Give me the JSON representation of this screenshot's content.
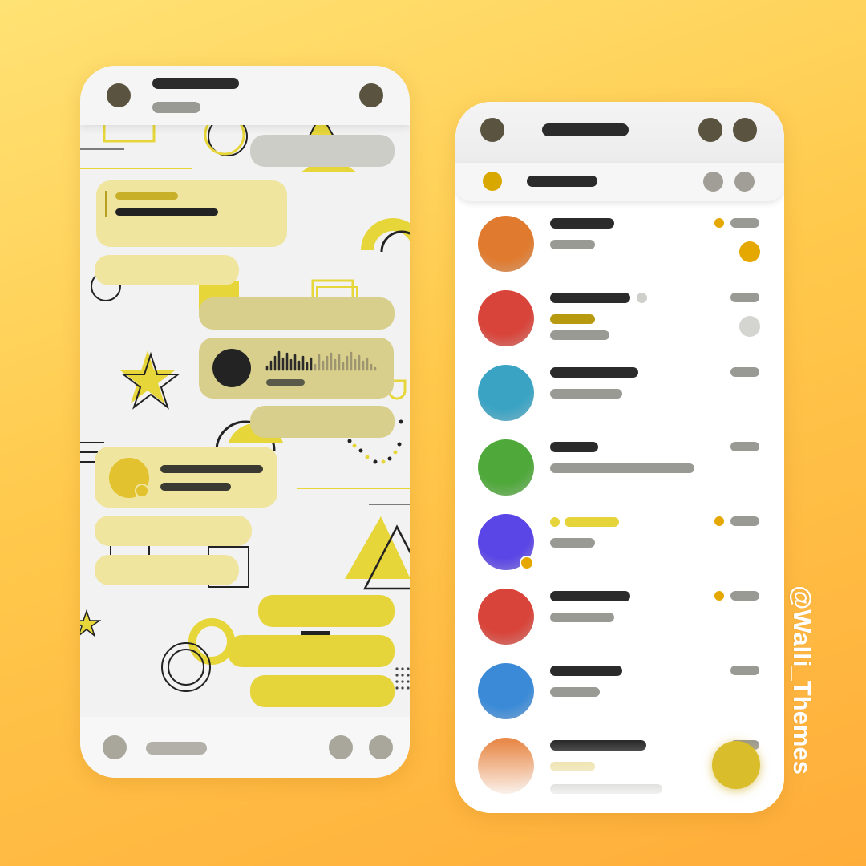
{
  "watermark": "@Walli_Themes",
  "colors": {
    "background_top": "#ffe274",
    "background_bottom": "#ffad3a",
    "accent_yellow": "#e5d43a",
    "unread_badge": "#e5a800",
    "skeleton_dark": "#2b2b2b",
    "skeleton_gray": "#9a9a95"
  },
  "chat_screen": {
    "header": {
      "icons": [
        "back-icon",
        "contact-avatar",
        "menu-icon"
      ]
    },
    "messages": [
      "incoming-gray",
      "incoming-reply",
      "incoming-short",
      "outgoing-gray",
      "outgoing-voice",
      "outgoing-gray",
      "incoming-contact",
      "incoming-pale",
      "incoming-pale",
      "outgoing-yellow",
      "outgoing-yellow",
      "outgoing-yellow"
    ],
    "voice_message": {
      "icon": "play-icon"
    },
    "composer": {
      "icons": [
        "emoji-icon",
        "attach-icon",
        "mic-icon"
      ]
    }
  },
  "chat_list_screen": {
    "topbar": {
      "icons": [
        "menu-icon",
        "search-icon",
        "more-icon"
      ]
    },
    "pinned_bar": {
      "icons": [
        "story-dot",
        "filter-icon",
        "edit-icon"
      ]
    },
    "avatar_colors": [
      "#e07a2e",
      "#d8443a",
      "#3aa3c4",
      "#4fa83a",
      "#5a45e6",
      "#d8443a",
      "#3a8ad8",
      "#e88a4a"
    ],
    "fab": {
      "icon": "compose-icon"
    }
  }
}
